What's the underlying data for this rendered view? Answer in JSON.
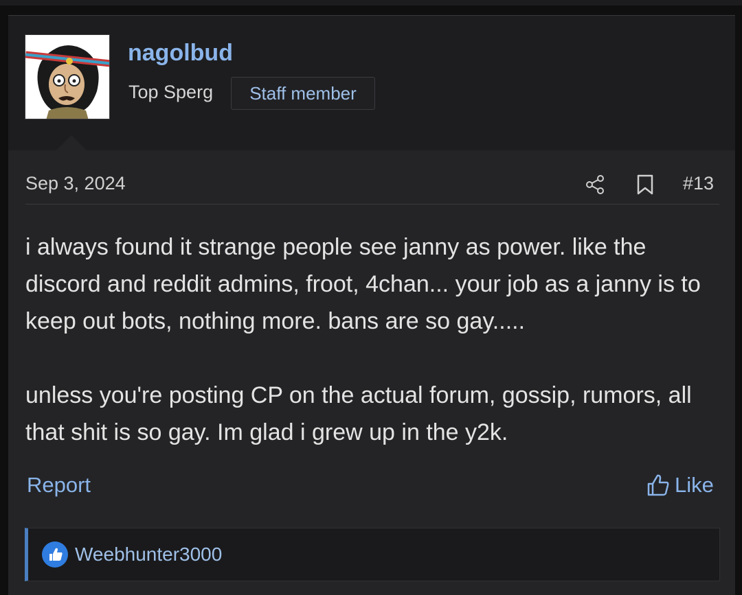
{
  "post": {
    "username": "nagolbud",
    "user_title": "Top Sperg",
    "badge": "Staff member",
    "date": "Sep 3, 2024",
    "post_number": "#13",
    "message_paragraphs": [
      "i always found it strange people see janny as power. like the discord and reddit admins, froot, 4chan... your job as a janny is to keep out bots, nothing more. bans are so gay.....",
      "unless you're posting CP on the actual forum, gossip, rumors, all that shit is so gay. Im glad i grew up in the y2k."
    ]
  },
  "actions": {
    "report_label": "Report",
    "like_label": "Like"
  },
  "reactions": {
    "users": "Weebhunter3000",
    "icon": "thumbs-up-icon"
  },
  "colors": {
    "link": "#8ab4ea",
    "background": "#242426",
    "reaction_accent": "#2f7de1"
  }
}
